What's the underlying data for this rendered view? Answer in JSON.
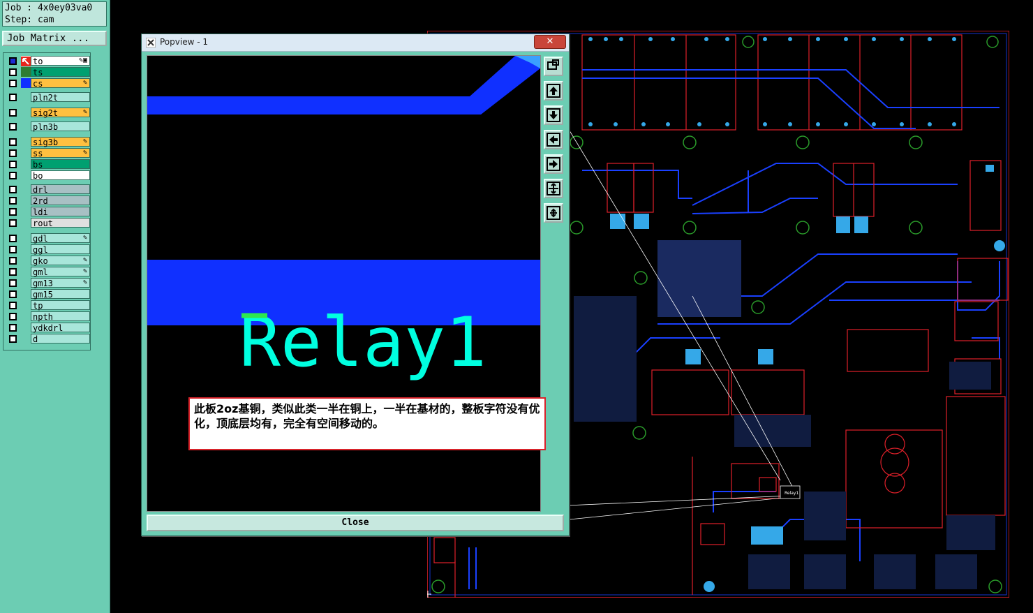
{
  "job_panel": {
    "job_line": "Job : 4x0ey03va0",
    "step_line": "Step: cam",
    "job_matrix_button": "Job Matrix ..."
  },
  "layers": [
    {
      "name": "to",
      "bg": "#ffffff",
      "swatch": "#ffffff",
      "checked": true,
      "edit": "✎▣"
    },
    {
      "name": "ts",
      "bg": "#00a070",
      "swatch": "#2e7d32",
      "checked": false,
      "edit": ""
    },
    {
      "name": "cs",
      "bg": "#ffc040",
      "swatch": "#1030ff",
      "checked": false,
      "edit": "✎"
    },
    {
      "name": "pln2t",
      "bg": "#a8e6da",
      "swatch": "",
      "checked": false,
      "edit": ""
    },
    {
      "name": "sig2t",
      "bg": "#ffc040",
      "swatch": "",
      "checked": false,
      "edit": "✎"
    },
    {
      "name": "pln3b",
      "bg": "#a8e6da",
      "swatch": "",
      "checked": false,
      "edit": ""
    },
    {
      "name": "sig3b",
      "bg": "#ffc040",
      "swatch": "",
      "checked": false,
      "edit": "✎"
    },
    {
      "name": "ss",
      "bg": "#ffc040",
      "swatch": "",
      "checked": false,
      "edit": "✎"
    },
    {
      "name": "bs",
      "bg": "#00a070",
      "swatch": "",
      "checked": false,
      "edit": ""
    },
    {
      "name": "bo",
      "bg": "#ffffff",
      "swatch": "",
      "checked": false,
      "edit": ""
    },
    {
      "name": "drl",
      "bg": "#a8c0c4",
      "swatch": "",
      "checked": false,
      "edit": ""
    },
    {
      "name": "2rd",
      "bg": "#a8c0c4",
      "swatch": "",
      "checked": false,
      "edit": ""
    },
    {
      "name": "ldi",
      "bg": "#a8c0c4",
      "swatch": "",
      "checked": false,
      "edit": ""
    },
    {
      "name": "rout",
      "bg": "#e0e0e0",
      "swatch": "",
      "checked": false,
      "edit": ""
    },
    {
      "name": "gdl",
      "bg": "#a8e6da",
      "swatch": "",
      "checked": false,
      "edit": "✎"
    },
    {
      "name": "ggl",
      "bg": "#a8e6da",
      "swatch": "",
      "checked": false,
      "edit": ""
    },
    {
      "name": "gko",
      "bg": "#a8e6da",
      "swatch": "",
      "checked": false,
      "edit": "✎"
    },
    {
      "name": "gml",
      "bg": "#a8e6da",
      "swatch": "",
      "checked": false,
      "edit": "✎"
    },
    {
      "name": "gm13",
      "bg": "#a8e6da",
      "swatch": "",
      "checked": false,
      "edit": "✎"
    },
    {
      "name": "gm15",
      "bg": "#a8e6da",
      "swatch": "",
      "checked": false,
      "edit": ""
    },
    {
      "name": "tp",
      "bg": "#a8e6da",
      "swatch": "",
      "checked": false,
      "edit": ""
    },
    {
      "name": "npth",
      "bg": "#a8e6da",
      "swatch": "",
      "checked": false,
      "edit": ""
    },
    {
      "name": "ydkdrl",
      "bg": "#a8e6da",
      "swatch": "",
      "checked": false,
      "edit": ""
    },
    {
      "name": "d",
      "bg": "#a8e6da",
      "swatch": "",
      "checked": false,
      "edit": ""
    }
  ],
  "popview": {
    "title": "Popview - 1",
    "close_x": "✕",
    "close_button": "Close",
    "silkscreen_text": "Relay1"
  },
  "board": {
    "relay_label": "Relay1"
  },
  "note": {
    "text": "此板2oz基铜，类似此类一半在铜上，一半在基材的，整板字符没有优化，顶底层均有，完全有空间移动的。"
  },
  "colors": {
    "panel": "#6ccdb3",
    "copper": "#1030ff",
    "outline": "#e0202a",
    "pad": "#35a8e8",
    "silk": "#00ffe0"
  }
}
